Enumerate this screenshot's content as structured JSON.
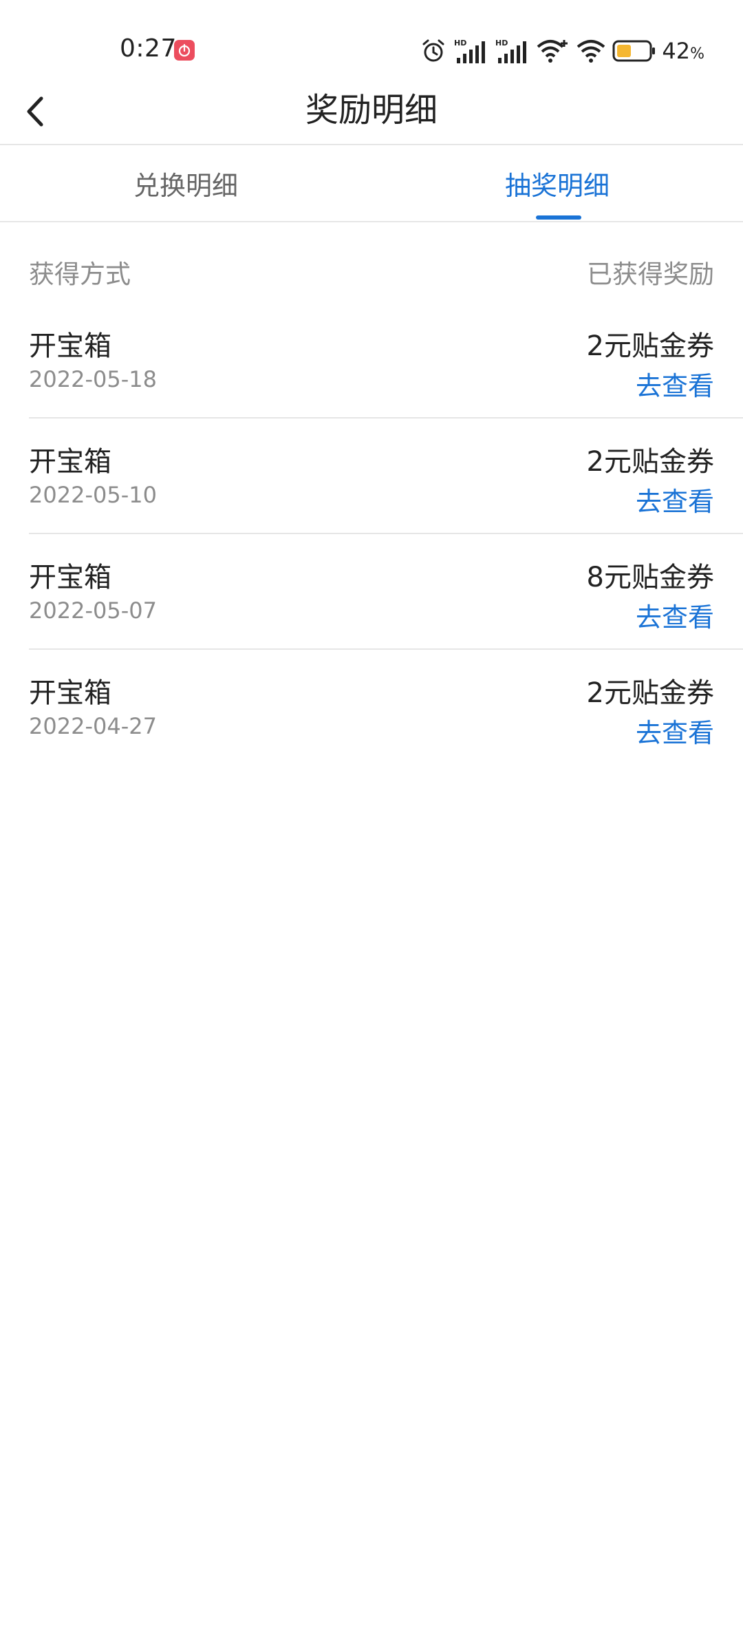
{
  "status_bar": {
    "time": "0:27",
    "icons": [
      "app-notification-icon",
      "alarm-icon",
      "hd-signal-icon",
      "hd-signal-icon",
      "wifi-plus-icon",
      "wifi-icon",
      "battery-icon"
    ],
    "battery_percent": "42",
    "battery_unit": "%",
    "battery_color": "#f5b731"
  },
  "header": {
    "back_icon": "chevron-left-icon",
    "title": "奖励明细"
  },
  "tabs": [
    {
      "label": "兑换明细",
      "active": false
    },
    {
      "label": "抽奖明细",
      "active": true
    }
  ],
  "accent_color": "#1a73d6",
  "list": {
    "header_left": "获得方式",
    "header_right": "已获得奖励",
    "rows": [
      {
        "method": "开宝箱",
        "date": "2022-05-18",
        "reward": "2元贴金券",
        "action": "去查看"
      },
      {
        "method": "开宝箱",
        "date": "2022-05-10",
        "reward": "2元贴金券",
        "action": "去查看"
      },
      {
        "method": "开宝箱",
        "date": "2022-05-07",
        "reward": "8元贴金券",
        "action": "去查看"
      },
      {
        "method": "开宝箱",
        "date": "2022-04-27",
        "reward": "2元贴金券",
        "action": "去查看"
      }
    ]
  }
}
